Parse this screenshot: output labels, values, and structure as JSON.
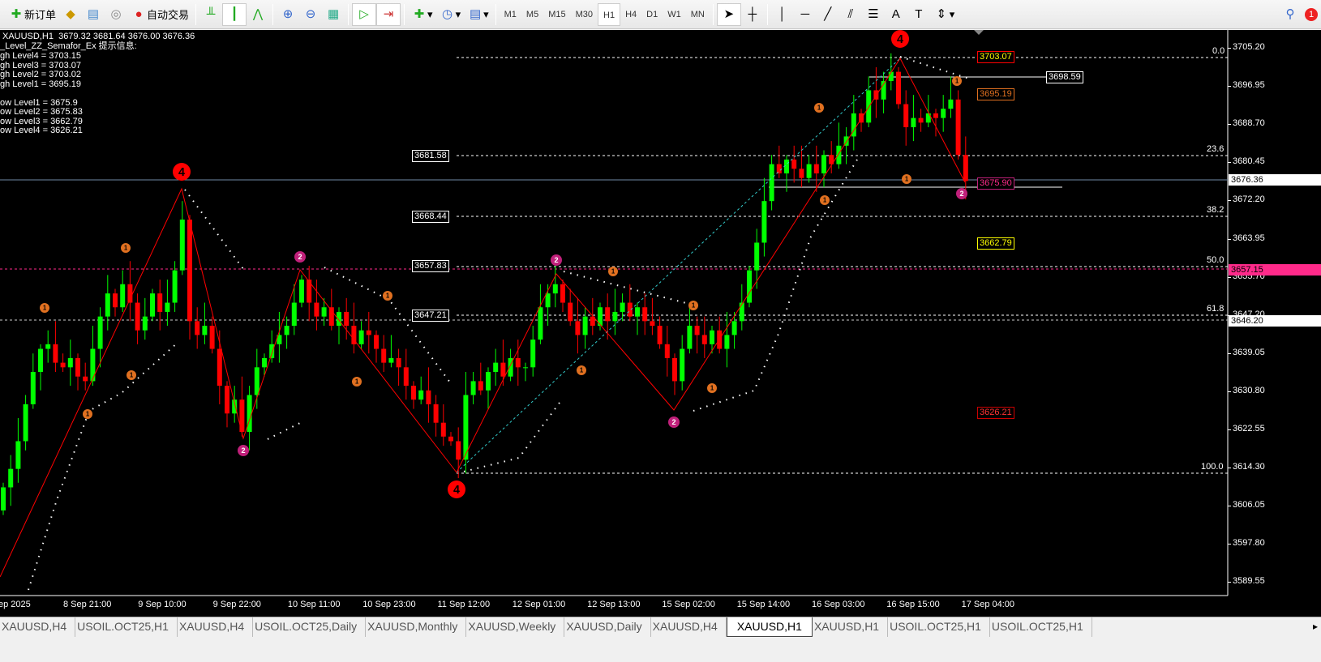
{
  "toolbar": {
    "new_order": "新订单",
    "auto_trading": "自动交易",
    "timeframes": [
      "M1",
      "M5",
      "M15",
      "M30",
      "H1",
      "H4",
      "D1",
      "W1",
      "MN"
    ],
    "active_timeframe": "H1",
    "notification_count": "1"
  },
  "info": {
    "header": "XAUUSD,H1  3679.32 3681.64 3676.00 3676.36",
    "indicator": "_Level_ZZ_Semafor_Ex 提示信息:",
    "lines": [
      "gh Level4 = 3703.15",
      "gh Level3 = 3703.07",
      "gh Level2 = 3703.02",
      "gh Level1 = 3695.19",
      "",
      "ow Level1 = 3675.9",
      "ow Level2 = 3675.83",
      "ow Level3 = 3662.79",
      "ow Level4 = 3626.21"
    ]
  },
  "price_axis": [
    "3705.20",
    "3696.95",
    "3688.70",
    "3680.45",
    "3672.20",
    "3663.95",
    "3655.70",
    "3647.20",
    "3639.05",
    "3630.80",
    "3622.55",
    "3614.30",
    "3606.05",
    "3597.80",
    "3589.55"
  ],
  "price_highlights": {
    "current": "3676.36",
    "pink_line": "3657.15",
    "gray_line": "3646.20"
  },
  "time_axis": [
    "ep 2025",
    "8 Sep 21:00",
    "9 Sep 10:00",
    "9 Sep 22:00",
    "10 Sep 11:00",
    "10 Sep 23:00",
    "11 Sep 12:00",
    "12 Sep 01:00",
    "12 Sep 13:00",
    "15 Sep 02:00",
    "15 Sep 14:00",
    "16 Sep 03:00",
    "16 Sep 15:00",
    "17 Sep 04:00"
  ],
  "fib": {
    "levels": [
      "0.0",
      "23.6",
      "38.2",
      "50.0",
      "61.8",
      "100.0"
    ],
    "prices": [
      "3681.58",
      "3668.44",
      "3657.83",
      "3647.21"
    ]
  },
  "level_boxes": {
    "high4": "3703.07",
    "high1": "3695.19",
    "low1": "3675.90",
    "low3": "3662.79",
    "low4": "3626.21",
    "line_label": "3698.59"
  },
  "semafor": {
    "big": "4",
    "mid": "2",
    "small": "1"
  },
  "colors": {
    "bull": "#00ff00",
    "bear": "#ff0000",
    "zigzag": "#ff0000",
    "pink": "#ff2a8a",
    "orange": "#e07020"
  },
  "chart_data": {
    "type": "candlestick",
    "symbol": "XAUUSD",
    "timeframe": "H1",
    "ylim": [
      3589.55,
      3705.2
    ],
    "first_open": 3605,
    "close": [
      3610,
      3614,
      3620,
      3628,
      3635,
      3640,
      3641,
      3637,
      3636,
      3638,
      3634,
      3633,
      3640,
      3647,
      3652,
      3649,
      3654,
      3650,
      3644,
      3647,
      3652,
      3648,
      3650,
      3657,
      3668,
      3646,
      3643,
      3645,
      3640,
      3632,
      3626,
      3629,
      3622,
      3630,
      3636,
      3638,
      3641,
      3643,
      3645,
      3650,
      3655,
      3650,
      3647,
      3649,
      3645,
      3648,
      3645,
      3641,
      3644,
      3643,
      3640,
      3637,
      3638,
      3636,
      3632,
      3629,
      3631,
      3628,
      3624,
      3621,
      3620,
      3616,
      3630,
      3633,
      3631,
      3635,
      3637,
      3634,
      3638,
      3636,
      3636,
      3642,
      3649,
      3652,
      3654,
      3650,
      3646,
      3643,
      3647,
      3645,
      3649,
      3646,
      3648,
      3650,
      3647,
      3649,
      3646,
      3645,
      3641,
      3638,
      3633,
      3640,
      3645,
      3643,
      3641,
      3644,
      3640,
      3643,
      3646,
      3650,
      3657,
      3663,
      3672,
      3680,
      3678,
      3681,
      3679,
      3677,
      3680,
      3678,
      3682,
      3680,
      3684,
      3686,
      3691,
      3689,
      3696,
      3694,
      3698,
      3700,
      3693,
      3688,
      3690,
      3689,
      3691,
      3690,
      3692,
      3694,
      3682,
      3676.36
    ]
  },
  "tabs": [
    "XAUUSD,H4",
    "USOIL.OCT25,H1",
    "XAUUSD,H4",
    "USOIL.OCT25,Daily",
    "XAUUSD,Monthly",
    "XAUUSD,Weekly",
    "XAUUSD,Daily",
    "XAUUSD,H4",
    "XAUUSD,H1",
    "XAUUSD,H1",
    "USOIL.OCT25,H1",
    "USOIL.OCT25,H1"
  ],
  "active_tab": 8
}
